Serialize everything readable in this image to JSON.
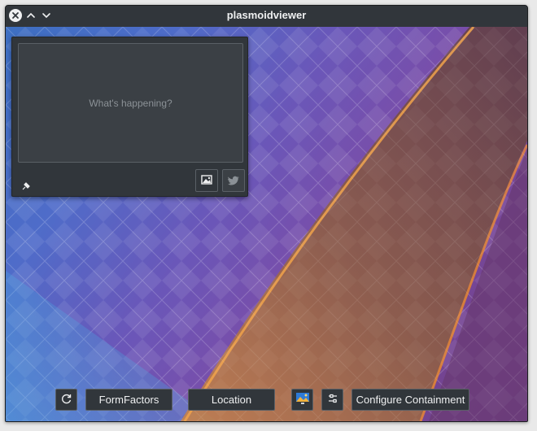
{
  "window": {
    "title": "plasmoidviewer",
    "controls": [
      "close-icon",
      "chevron-up-icon",
      "chevron-down-icon"
    ]
  },
  "widget": {
    "compose_placeholder": "What's happening?",
    "icons": [
      "pin-icon",
      "image-icon",
      "twitter-icon"
    ]
  },
  "toolbar": {
    "refresh_icon": "refresh-icon",
    "formfactors_label": "FormFactors",
    "location_label": "Location",
    "wallpaper_icon": "wallpaper-icon",
    "settings_icon": "configure-icon",
    "configure_label": "Configure Containment"
  },
  "colors": {
    "window_bg": "#31363b",
    "text": "#eff0f1",
    "border": "#5a6066",
    "placeholder": "#8b9196"
  }
}
